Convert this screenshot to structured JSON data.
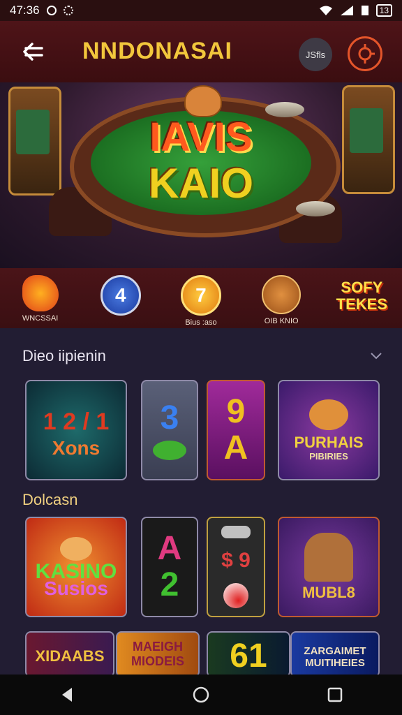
{
  "status_bar": {
    "time": "47:36",
    "battery": "13"
  },
  "header": {
    "title": "NNDONASAI",
    "badge_text": "JSfls"
  },
  "hero": {
    "title_line1": "IAVIS",
    "title_line2": "KAIO"
  },
  "icon_strip": [
    {
      "label": "WNCSSAI",
      "icon": "fire-ball-icon",
      "text": ""
    },
    {
      "label": "",
      "icon": "number-4-icon",
      "text": "4"
    },
    {
      "label": "Bius :aso",
      "icon": "number-7-icon",
      "text": "7"
    },
    {
      "label": "OIB KNIO",
      "icon": "tiger-icon",
      "text": ""
    },
    {
      "label": "",
      "icon": "wordart-icon",
      "text": "SOFY TEKES"
    }
  ],
  "sections": [
    {
      "title": "Dieo iipienin",
      "tiles": [
        {
          "big": "1 2 / 1",
          "caption": "Xons"
        },
        {
          "big": "3",
          "caption": ""
        },
        {
          "big": "9",
          "caption": "A"
        },
        {
          "big": "",
          "caption": "PURHAIS",
          "sub": "PIBIRIES"
        }
      ]
    },
    {
      "title": "Dolcasn",
      "tiles": [
        {
          "big": "",
          "caption": "KASINO",
          "sub": "Susios"
        },
        {
          "big": "A",
          "caption": "2"
        },
        {
          "big": "$ 9",
          "caption": ""
        },
        {
          "big": "",
          "caption": "MUBL8"
        }
      ]
    }
  ],
  "bottom_row": [
    {
      "caption": "XIDAABS"
    },
    {
      "caption": "MAEIGH",
      "sub": "MIODEIS"
    },
    {
      "big": "61"
    },
    {
      "caption": "ZARGAIMET",
      "sub": "MUITIHEIES"
    }
  ],
  "colors": {
    "header_bg": "#4e1418",
    "title_gold": "#f2c73c",
    "accent_orange": "#e4552a",
    "page_bg": "#221d33"
  }
}
